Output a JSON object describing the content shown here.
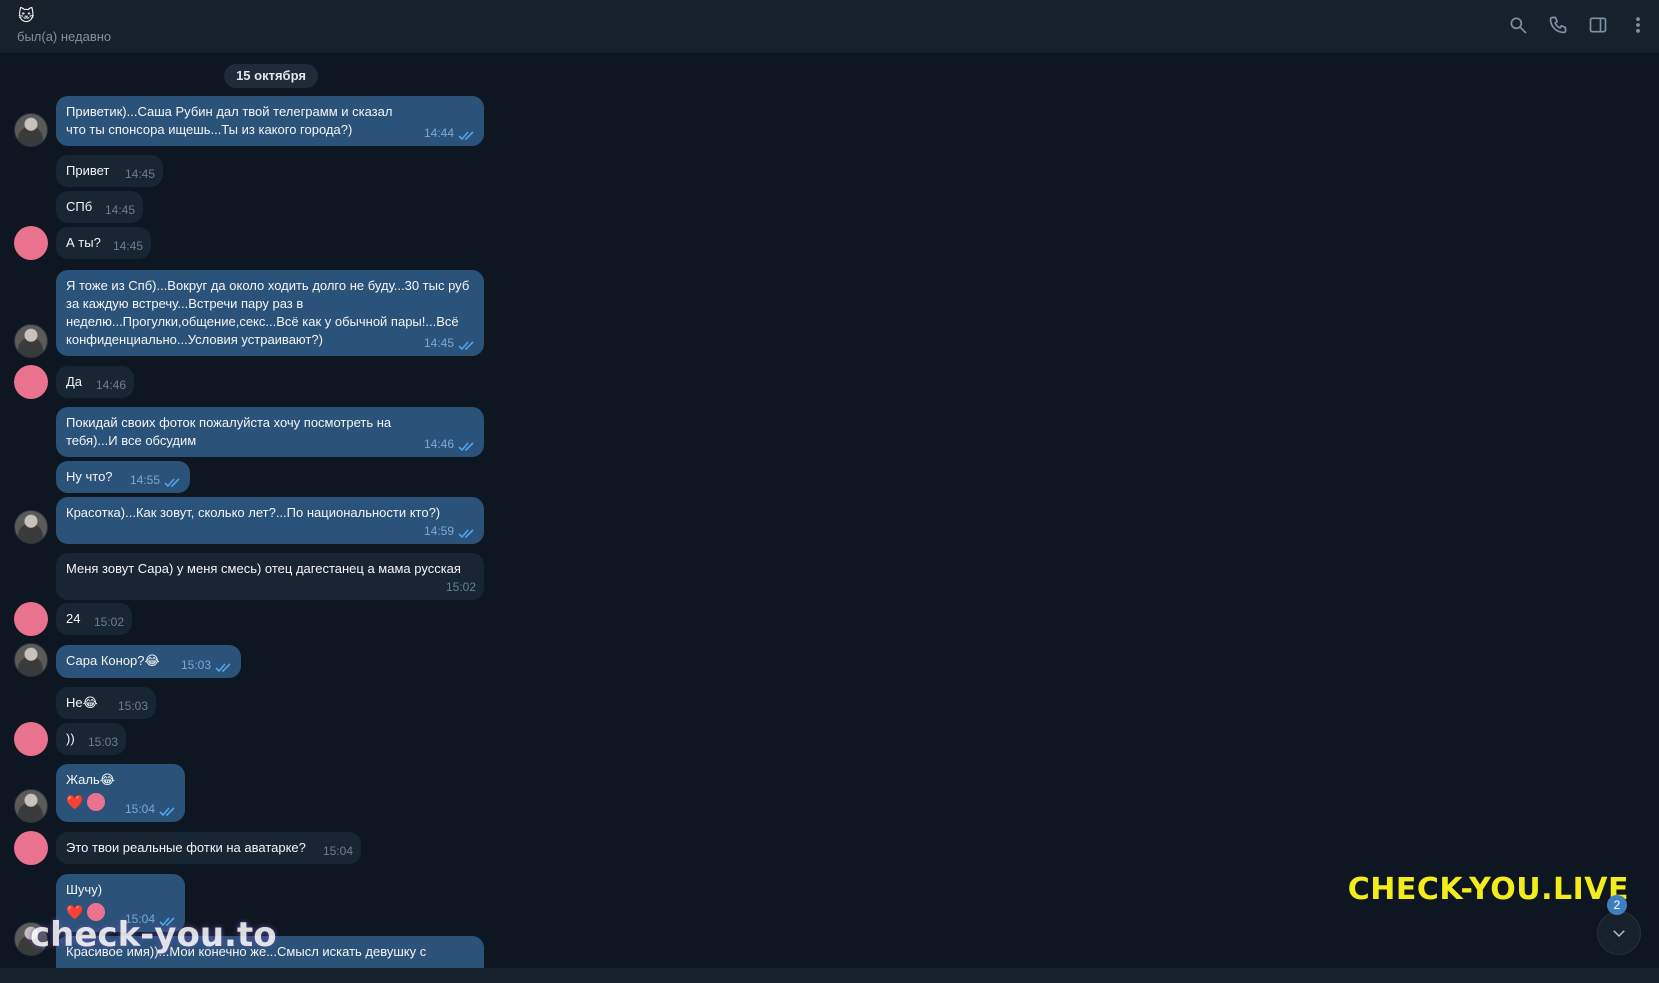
{
  "header": {
    "contact_emoji": "🐱",
    "status": "был(а) недавно",
    "icons": [
      "search-icon",
      "phone-icon",
      "sidebar-toggle-icon",
      "more-vertical-icon"
    ]
  },
  "chat": {
    "date": "15 октября",
    "messages": [
      {
        "dir": "out",
        "text": "Приветик)...Саша Рубин дал твой телеграмм и сказал что ты спонсора ищешь...Ты из какого города?)",
        "time": "14:44",
        "read": true,
        "avatar": "photo"
      },
      {
        "dir": "in",
        "text": "Привет",
        "time": "14:45"
      },
      {
        "dir": "in",
        "text": "СПб",
        "time": "14:45"
      },
      {
        "dir": "in",
        "text": "А ты?",
        "time": "14:45",
        "avatar": "pink"
      },
      {
        "dir": "out",
        "text": "Я тоже из Спб)...Вокруг да около ходить долго не буду...30 тыс руб за каждую встречу...Встречи пару раз в неделю...Прогулки,общение,секс...Всё как у обычной пары!...Всё конфиденциально...Условия устраивают?)",
        "time": "14:45",
        "read": true,
        "avatar": "photo"
      },
      {
        "dir": "in",
        "text": "Да",
        "time": "14:46",
        "avatar": "pink"
      },
      {
        "dir": "out",
        "text": "Покидай своих фоток пожалуйста хочу посмотреть на тебя)...И все обсудим",
        "time": "14:46",
        "read": true
      },
      {
        "dir": "out",
        "text": "Ну что?",
        "time": "14:55",
        "read": true
      },
      {
        "dir": "out",
        "text": "Красотка)...Как зовут, сколько лет?...По национальности кто?)",
        "time": "14:59",
        "read": true,
        "avatar": "photo"
      },
      {
        "dir": "in",
        "text": "Меня зовут Сара) у меня смесь) отец дагестанец а мама русская",
        "time": "15:02"
      },
      {
        "dir": "in",
        "text": "24",
        "time": "15:02",
        "avatar": "pink"
      },
      {
        "dir": "out",
        "text": "Сара Конор?😂",
        "time": "15:03",
        "read": true,
        "avatar": "photo"
      },
      {
        "dir": "in",
        "text": "Не😂",
        "time": "15:03"
      },
      {
        "dir": "in",
        "text": "))",
        "time": "15:03",
        "avatar": "pink"
      },
      {
        "dir": "out",
        "text": "Жаль😂",
        "time": "15:04",
        "read": true,
        "reactions": [
          "❤️"
        ],
        "avatar": "photo"
      },
      {
        "dir": "in",
        "text": "Это твои реальные фотки на аватарке?",
        "time": "15:04",
        "avatar": "pink"
      },
      {
        "dir": "out",
        "text": "Шучу)",
        "time": "15:04",
        "read": true,
        "reactions": [
          "❤️"
        ]
      },
      {
        "dir": "out",
        "text": "Красивое имя))...Мои конечно же...Смысл искать девушку с",
        "time": "",
        "read": false,
        "avatar": "photo"
      }
    ]
  },
  "watermarks": {
    "left": "check-you.to",
    "right": "CHECK-YOU.LIVE"
  },
  "scroll_down": {
    "badge_count": "2"
  },
  "colors": {
    "background": "#0e1621",
    "header": "#17212b",
    "outgoing_bubble": "#2b5278",
    "incoming_bubble": "#182533",
    "avatar_pink": "#e9738e",
    "watermark_yellow": "#f3ec1d"
  }
}
